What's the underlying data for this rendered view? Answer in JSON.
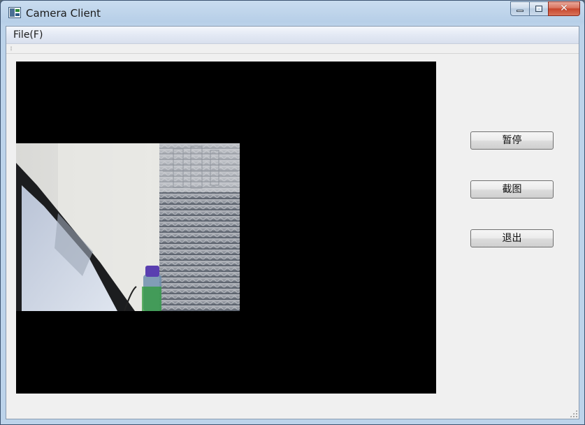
{
  "window": {
    "title": "Camera Client"
  },
  "menu": {
    "file_label": "File(F)"
  },
  "controls": {
    "pause_label": "暂停",
    "screenshot_label": "截图",
    "exit_label": "退出"
  },
  "caption": {
    "close_glyph": "✕"
  },
  "icons": {
    "app": "camera-client-app-icon",
    "minimize": "minimize-icon",
    "maximize": "maximize-icon",
    "close": "close-icon"
  },
  "colors": {
    "video_background": "#000000",
    "client_background": "#f0f0f0"
  }
}
